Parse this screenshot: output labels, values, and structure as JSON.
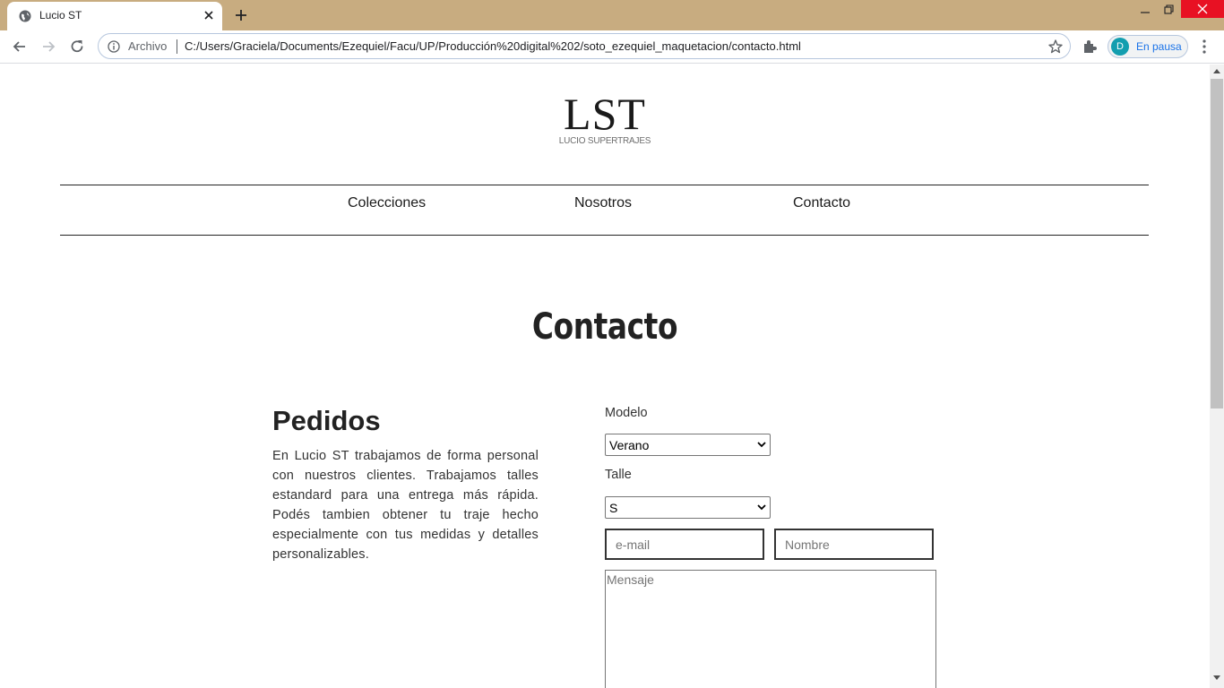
{
  "browser": {
    "tab_title": "Lucio ST",
    "omnibox_chip": "Archivo",
    "url": "C:/Users/Graciela/Documents/Ezequiel/Facu/UP/Producción%20digital%202/soto_ezequiel_maquetacion/contacto.html",
    "profile_initial": "D",
    "profile_status": "En pausa"
  },
  "logo": {
    "main": "LST",
    "sub": "LUCIO SUPERTRAJES"
  },
  "nav": {
    "items": [
      "Colecciones",
      "Nosotros",
      "Contacto"
    ]
  },
  "page": {
    "heading": "Contacto"
  },
  "pedidos": {
    "title": "Pedidos",
    "text": "En Lucio ST trabajamos de forma personal con nuestros clientes. Trabajamos talles estandard para una entrega más rápida. Podés tambien obtener tu traje hecho especialmente con tus medidas y detalles personalizables."
  },
  "form": {
    "modelo_label": "Modelo",
    "modelo_value": "Verano",
    "talle_label": "Talle",
    "talle_value": "S",
    "email_placeholder": "e-mail",
    "nombre_placeholder": "Nombre",
    "mensaje_placeholder": "Mensaje"
  },
  "colors": {
    "tab_strip": "#c8ac80",
    "close_button": "#e81123",
    "avatar": "#129eaf"
  }
}
